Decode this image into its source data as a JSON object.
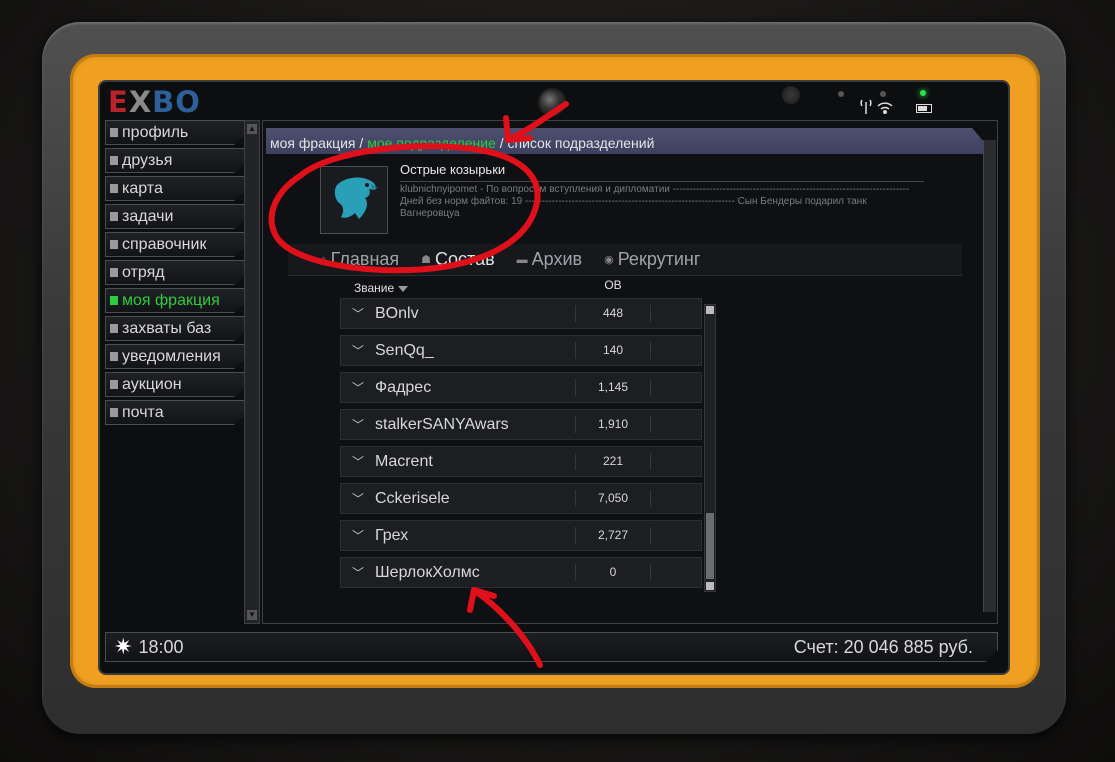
{
  "logo": {
    "e": "E",
    "x": "X",
    "bo": "BO"
  },
  "sidebar": {
    "items": [
      {
        "label": "профиль"
      },
      {
        "label": "друзья"
      },
      {
        "label": "карта"
      },
      {
        "label": "задачи"
      },
      {
        "label": "справочник"
      },
      {
        "label": "отряд"
      },
      {
        "label": "моя фракция",
        "active": true
      },
      {
        "label": "захваты баз"
      },
      {
        "label": "уведомления"
      },
      {
        "label": "аукцион"
      },
      {
        "label": "почта"
      }
    ]
  },
  "breadcrumb": {
    "part1": "моя фракция",
    "sep1": " / ",
    "part2": "мое подразделение",
    "sep2": " / ",
    "part3": "список подразделений"
  },
  "faction": {
    "name": "Острые козырьки",
    "description_line1": "klubnichnyipomet - По вопросам вступления и дипломатии -----------------------------------------------------------------------",
    "description_line2": "Дней без норм файтов: 19 --------------------------------------------------------------- Сын Бендеры подарил танк",
    "description_line3": "Вагнеровцуа"
  },
  "tabs": [
    {
      "label": "Главная",
      "icon": "home-icon"
    },
    {
      "label": "Состав",
      "icon": "members-icon",
      "active": true
    },
    {
      "label": "Архив",
      "icon": "folder-icon"
    },
    {
      "label": "Рекрутинг",
      "icon": "recruit-icon"
    }
  ],
  "table": {
    "headers": {
      "rank": "Звание",
      "ov": "ОВ"
    },
    "rows": [
      {
        "name": "BOnlv",
        "ov": "448"
      },
      {
        "name": "SenQq_",
        "ov": "140"
      },
      {
        "name": "Фадрес",
        "ov": "1,145"
      },
      {
        "name": "stalkerSANYAwars",
        "ov": "1,910"
      },
      {
        "name": "Macrent",
        "ov": "221"
      },
      {
        "name": "Cckerisele",
        "ov": "7,050"
      },
      {
        "name": "Грех",
        "ov": "2,727"
      },
      {
        "name": "ШерлокХолмс",
        "ov": "0"
      }
    ]
  },
  "status": {
    "time": "18:00",
    "account": "Счет: 20 046 885 руб."
  },
  "colors": {
    "bezel": "#f0a020",
    "active_green": "#2ecc40",
    "annotation_red": "#e0101a",
    "eagle": "#2a9fb8"
  }
}
